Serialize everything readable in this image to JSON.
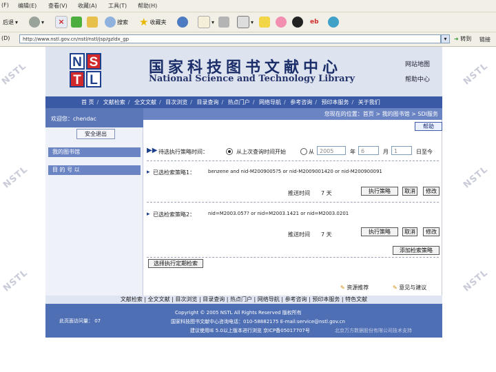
{
  "browser": {
    "menu": [
      "(F)",
      "编辑(E)",
      "查看(V)",
      "收藏(A)",
      "工具(T)",
      "帮助(H)"
    ],
    "toolbar": {
      "back_label": "后退",
      "search_label": "搜索",
      "favorites_label": "收藏夹"
    },
    "address_label": "(D)",
    "url": "http://www.nstl.gov.cn/nstl/nstl/jsp/gzldx_gp",
    "go_label": "转到",
    "links_label": "链接"
  },
  "watermark": "NSTL",
  "site": {
    "logo": [
      "N",
      "S",
      "T",
      "L"
    ],
    "cn_title": "国家科技图书文献中心",
    "en_title": "National Science and Technology Library",
    "header_links": [
      "网站地图",
      "帮助中心"
    ],
    "nav": [
      "首 页",
      "文献检索",
      "全文文献",
      "目次浏览",
      "目录查询",
      "热点门户",
      "网络导航",
      "参考咨询",
      "预印本服务",
      "关于我们"
    ]
  },
  "sidebar": {
    "welcome": "欢迎您：chendac",
    "logout": "安全退出",
    "items": [
      "我的图书馆",
      "目  的  号  以"
    ]
  },
  "breadcrumb": "您现在的位置：首页 > 我的图书馆 > SDI服务",
  "help_label": "帮助",
  "form": {
    "run_time_label": "待选执行策略时间：",
    "option1": "从上次查询时间开始",
    "option2": "从",
    "year": "2005",
    "year_unit": "年",
    "month": "6",
    "month_unit": "月",
    "day": "1",
    "day_unit": "日至今",
    "strategies": [
      {
        "label": "已选检索策略1：",
        "query": "benzene and nid-M2009005?5 or nid-M2009001420 or nid-M200900091",
        "interval_label": "推送时间",
        "interval_value": "7 天",
        "buttons": [
          "执行策略",
          "取消",
          "修改"
        ]
      },
      {
        "label": "已选检索策略2：",
        "query": "nid=M2003.057? or nid=M2003.1421 or nid=M2003.0201",
        "interval_label": "推送时间",
        "interval_value": "7 天",
        "buttons": [
          "执行策略",
          "取消",
          "修改"
        ]
      }
    ],
    "add_button": "添加检索策略",
    "select_button": "选择执行定期检索",
    "links": [
      "资源推荐",
      "意见与建议"
    ]
  },
  "footer": {
    "links": [
      "文献检索",
      "全文文献",
      "目次浏览",
      "目录查询",
      "热点门户",
      "网络导航",
      "参考咨询",
      "预印本服务",
      "特色文献"
    ],
    "visits": "此页面访问量：  07",
    "copyright": "Copyright © 2005 NSTL All Rights Reserved 版权所有",
    "address": "国家科技图书文献中心咨询电话：010-58882175  E-mail:service@nstl.gov.cn",
    "browser_note": "建议使用IE 5.0以上版本进行浏览    京ICP备05017707号",
    "support": "北京万方数据股份有限公司技术支持"
  }
}
